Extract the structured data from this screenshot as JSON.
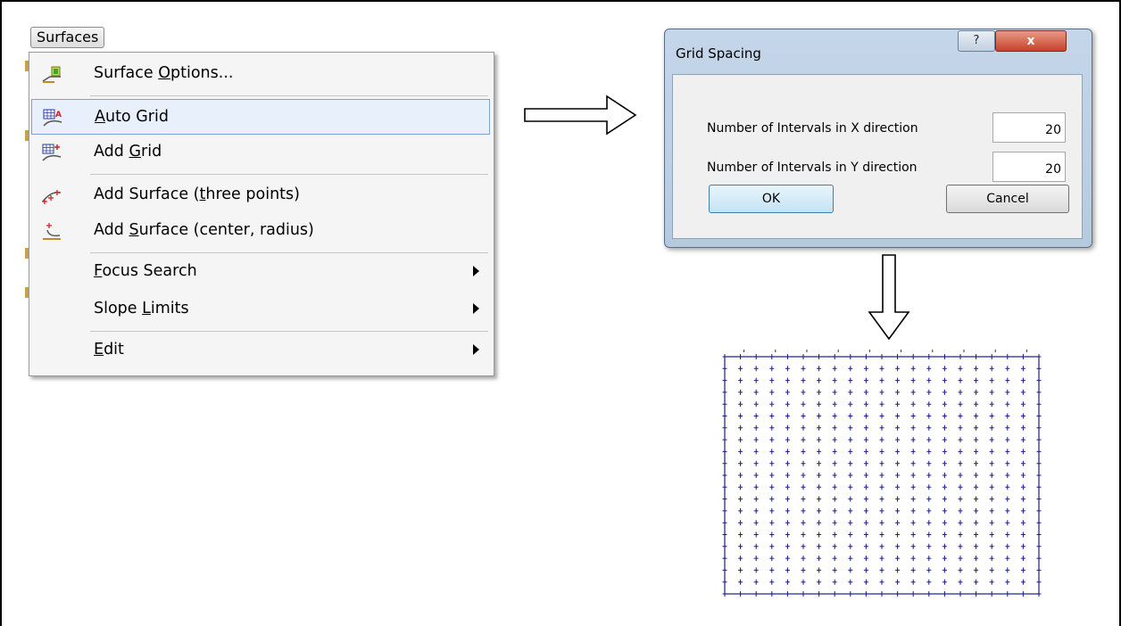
{
  "menu": {
    "title": "Surfaces",
    "items": [
      {
        "pre": "Surface ",
        "key": "O",
        "post": "ptions...",
        "icon": "surface-options-icon",
        "submenu": false,
        "highlighted": false
      },
      {
        "pre": "",
        "key": "A",
        "post": "uto Grid",
        "icon": "auto-grid-icon",
        "submenu": false,
        "highlighted": true
      },
      {
        "pre": "Add ",
        "key": "G",
        "post": "rid",
        "icon": "add-grid-icon",
        "submenu": false,
        "highlighted": false
      },
      {
        "pre": "Add Surface (",
        "key": "t",
        "post": "hree points)",
        "icon": "add-surface-three-points-icon",
        "submenu": false,
        "highlighted": false
      },
      {
        "pre": "Add ",
        "key": "S",
        "post": "urface (center, radius)",
        "icon": "add-surface-center-radius-icon",
        "submenu": false,
        "highlighted": false
      },
      {
        "pre": "",
        "key": "F",
        "post": "ocus Search",
        "icon": "",
        "submenu": true,
        "highlighted": false
      },
      {
        "pre": "Slope ",
        "key": "L",
        "post": "imits",
        "icon": "",
        "submenu": true,
        "highlighted": false
      },
      {
        "pre": "",
        "key": "E",
        "post": "dit",
        "icon": "",
        "submenu": true,
        "highlighted": false
      }
    ]
  },
  "dialog": {
    "title": "Grid Spacing",
    "help_label": "?",
    "close_label": "x",
    "x_label": "Number of Intervals in X direction",
    "x_value": "20",
    "y_label": "Number of Intervals in Y direction",
    "y_value": "20",
    "ok_label": "OK",
    "cancel_label": "Cancel"
  },
  "grid": {
    "x_intervals": 20,
    "y_intervals": 20,
    "color": "#1a1a8c"
  },
  "colors": {
    "highlight_fill": "#e8f1fb",
    "highlight_border": "#7da2ce",
    "dialog_frame": "#b6cade",
    "close_button": "#c8412a"
  }
}
